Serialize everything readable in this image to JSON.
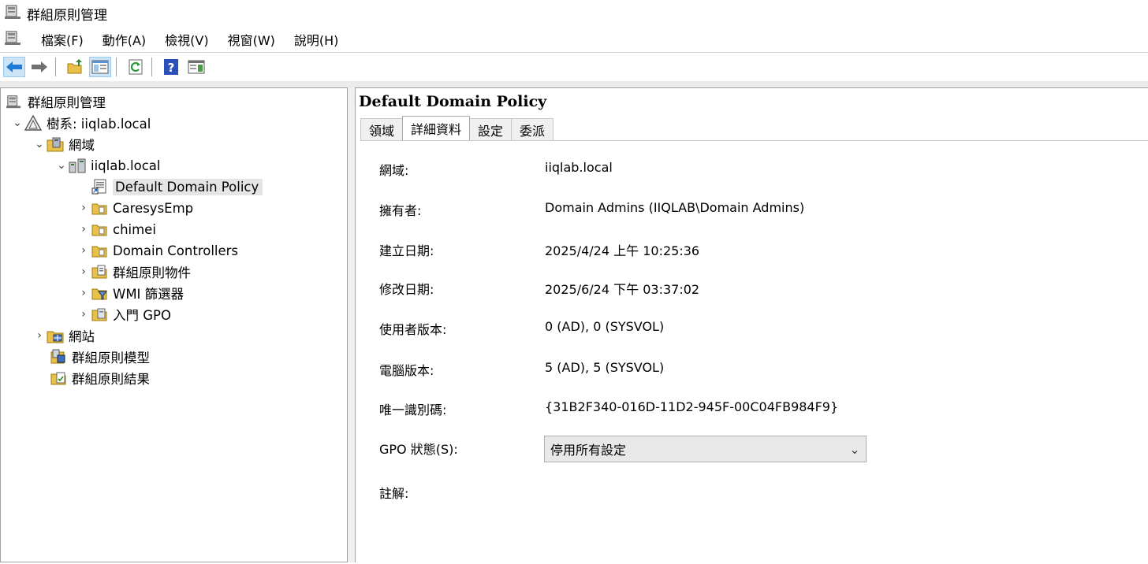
{
  "window": {
    "title": "群組原則管理"
  },
  "menu": {
    "items": [
      "檔案(F)",
      "動作(A)",
      "檢視(V)",
      "視窗(W)",
      "說明(H)"
    ]
  },
  "toolbar": {
    "buttons": [
      "back-icon",
      "forward-icon",
      "up-folder-icon",
      "show-hide-tree-icon",
      "refresh-icon",
      "help-icon",
      "show-pane-icon"
    ]
  },
  "tree": {
    "root": "群組原則管理",
    "forest": "樹系: iiqlab.local",
    "domains": "網域",
    "domain": "iiqlab.local",
    "items": [
      {
        "label": "Default Domain Policy"
      },
      {
        "label": "CaresysEmp"
      },
      {
        "label": "chimei"
      },
      {
        "label": "Domain Controllers"
      },
      {
        "label": "群組原則物件"
      },
      {
        "label": "WMI 篩選器"
      },
      {
        "label": "入門 GPO"
      }
    ],
    "sites": "網站",
    "modeling": "群組原則模型",
    "results": "群組原則結果"
  },
  "details": {
    "title": "Default Domain Policy",
    "tabs": [
      "領域",
      "詳細資料",
      "設定",
      "委派"
    ],
    "active_tab": "詳細資料",
    "fields": [
      {
        "label": "網域:",
        "value": "iiqlab.local"
      },
      {
        "label": "擁有者:",
        "value": "Domain Admins (IIQLAB\\Domain Admins)"
      },
      {
        "label": "建立日期:",
        "value": "2025/4/24 上午 10:25:36"
      },
      {
        "label": "修改日期:",
        "value": "2025/6/24 下午 03:37:02"
      },
      {
        "label": "使用者版本:",
        "value": "0 (AD), 0 (SYSVOL)"
      },
      {
        "label": "電腦版本:",
        "value": "5 (AD), 5 (SYSVOL)"
      },
      {
        "label": "唯一識別碼:",
        "value": "{31B2F340-016D-11D2-945F-00C04FB984F9}"
      }
    ],
    "gpo_status_label": "GPO 狀態(S):",
    "gpo_status_value": "停用所有設定",
    "comment_label": "註解:"
  }
}
